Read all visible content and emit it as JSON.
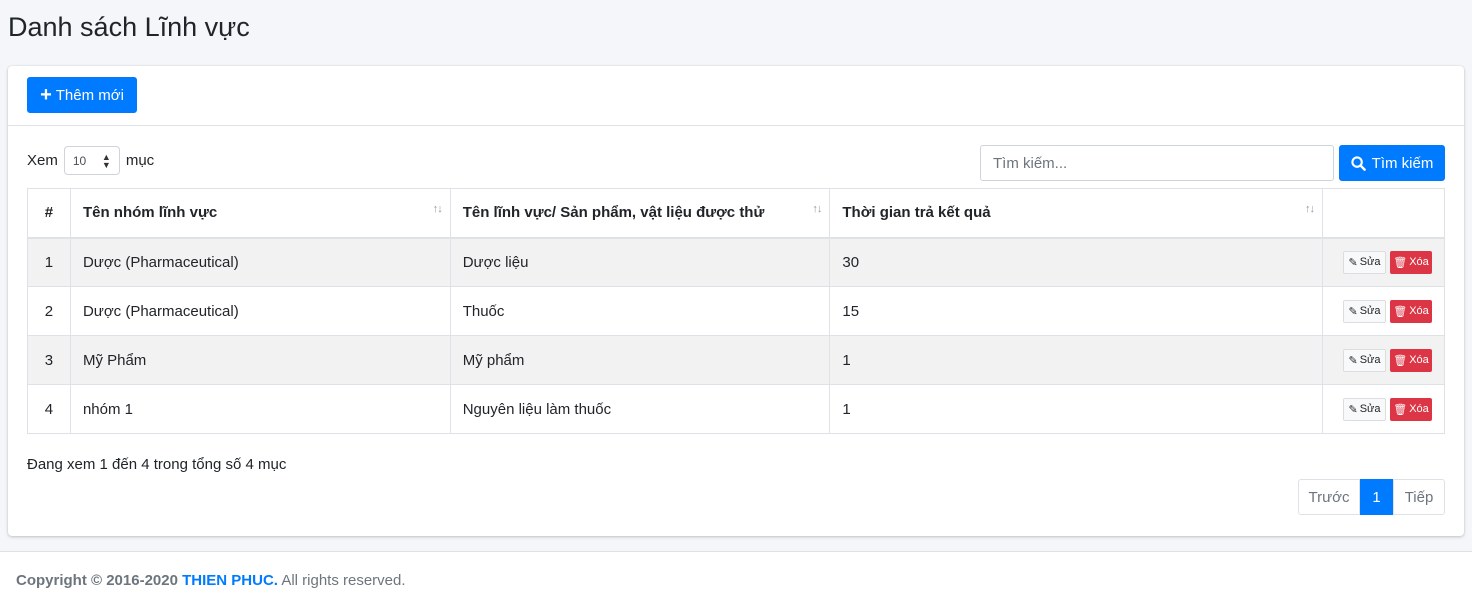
{
  "page": {
    "title": "Danh sách Lĩnh vực"
  },
  "toolbar": {
    "add_label": "Thêm mới"
  },
  "length": {
    "prefix": "Xem",
    "value": "10",
    "suffix": "mục"
  },
  "search": {
    "placeholder": "Tìm kiếm...",
    "button_label": "Tìm kiếm"
  },
  "table": {
    "headers": [
      "#",
      "Tên nhóm lĩnh vực",
      "Tên lĩnh vực/ Sản phẩm, vật liệu được thử",
      "Thời gian trả kết quả",
      ""
    ],
    "rows": [
      {
        "num": "1",
        "group": "Dược (Pharmaceutical)",
        "field": "Dược liệu",
        "time": "30"
      },
      {
        "num": "2",
        "group": "Dược (Pharmaceutical)",
        "field": "Thuốc",
        "time": "15"
      },
      {
        "num": "3",
        "group": "Mỹ Phẩm",
        "field": "Mỹ phẩm",
        "time": "1"
      },
      {
        "num": "4",
        "group": "nhóm 1",
        "field": "Nguyên liệu làm thuốc",
        "time": "1"
      }
    ],
    "edit_label": "Sửa",
    "delete_label": "Xóa"
  },
  "info": "Đang xem 1 đến 4 trong tổng số 4 mục",
  "pagination": {
    "prev": "Trước",
    "current": "1",
    "next": "Tiếp"
  },
  "footer": {
    "copyright": "Copyright © 2016-2020",
    "brand": "THIEN PHUC.",
    "rights": "All rights reserved."
  },
  "colors": {
    "primary": "#007bff",
    "danger": "#dc3545"
  }
}
